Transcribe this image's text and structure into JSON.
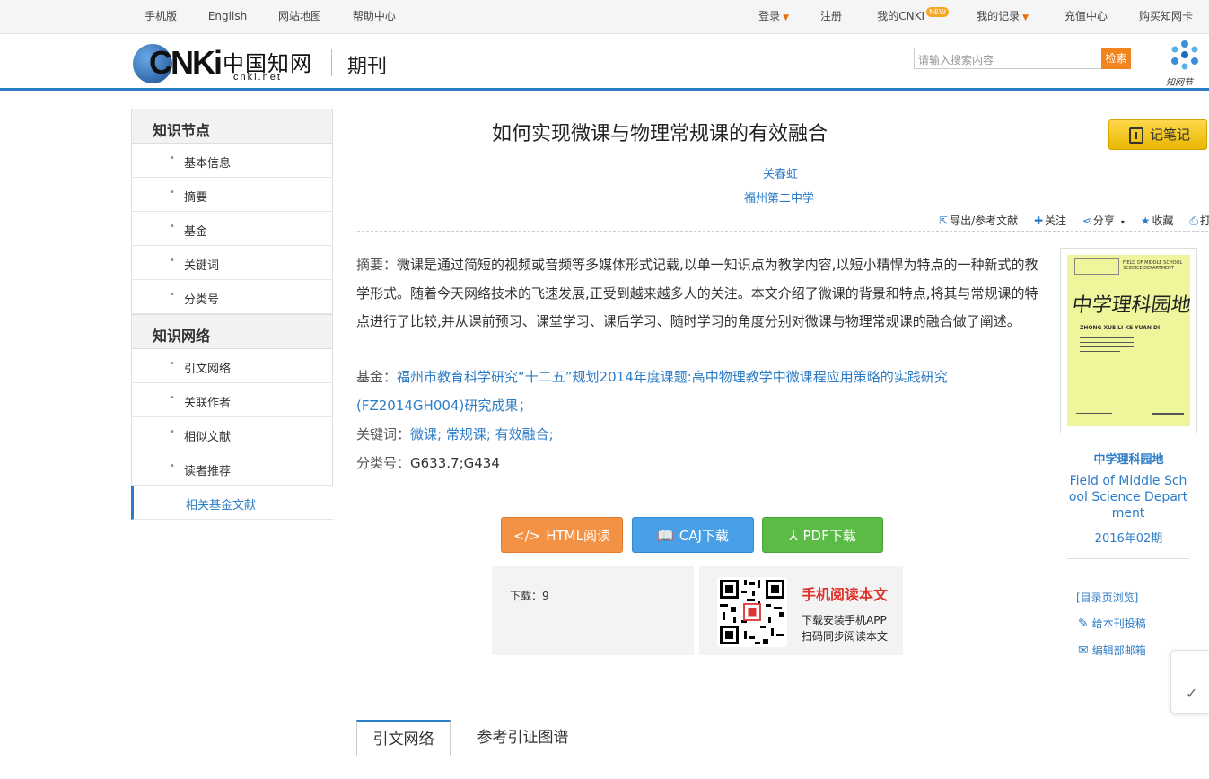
{
  "topbar": {
    "left": [
      "手机版",
      "English",
      "网站地图",
      "帮助中心"
    ],
    "login": "登录",
    "register": "注册",
    "my_cnki": "我的CNKI",
    "new_badge": "NEW",
    "my_records": "我的记录",
    "recharge": "充值中心",
    "buy_card": "购买知网卡"
  },
  "header": {
    "logo_letters": "CNKi",
    "logo_cn": "中国知网",
    "logo_sub": "cnki.net",
    "section": "期刊",
    "search_placeholder": "请输入搜索内容",
    "search_button": "检索",
    "zhiwang_text": "知网节"
  },
  "sidebar": {
    "node_head": "知识节点",
    "node_items": [
      "基本信息",
      "摘要",
      "基金",
      "关键词",
      "分类号"
    ],
    "network_head": "知识网络",
    "network_items": [
      "引文网络",
      "关联作者",
      "相似文献",
      "读者推荐",
      "相关基金文献"
    ]
  },
  "article": {
    "title": "如何实现微课与物理常规课的有效融合",
    "note_button": "记笔记",
    "author": "关春虹",
    "org": "福州第二中学",
    "tools": [
      "导出/参考文献",
      "关注",
      "分享",
      "收藏",
      "打印"
    ],
    "abstract_label": "摘要：",
    "abstract": "微课是通过简短的视频或音频等多媒体形式记载,以单一知识点为教学内容,以短小精悍为特点的一种新式的教学形式。随着今天网络技术的飞速发展,正受到越来越多人的关注。本文介绍了微课的背景和特点,将其与常规课的特点进行了比较,并从课前预习、课堂学习、课后学习、随时学习的角度分别对微课与物理常规课的融合做了阐述。",
    "fund_label": "基金：",
    "fund": "福州市教育科学研究“十二五”规划2014年度课题:高中物理教学中微课程应用策略的实践研究(FZ2014GH004)研究成果；",
    "keywords_label": "关键词：",
    "keywords": "微课; 常规课; 有效融合;",
    "clc_label": "分类号：",
    "clc": "G633.7;G434"
  },
  "downloads": {
    "html": "HTML阅读",
    "caj": "CAJ下载",
    "pdf": "PDF下载",
    "count_label": "下载：",
    "count": "9",
    "mobile_title": "手机阅读本文",
    "mobile_line1": "下载安装手机APP",
    "mobile_line2": "扫码同步阅读本文"
  },
  "journal": {
    "cover_title": "中学理科园地",
    "cover_sub": "ZHONG XUE LI KE YUAN DI",
    "cover_top": "FIELD OF MIDDLE SCHOOL SCIENCE DEPARTMENT",
    "name_cn": "中学理科园地",
    "name_en": "Field of Middle School Science Department",
    "issue": "2016年02期",
    "browse": "[目录页浏览]",
    "submit": "给本刊投稿",
    "editor_mail": "编辑部邮箱"
  },
  "tabs": [
    "引文网络",
    "参考引证图谱"
  ],
  "colors": {
    "accent": "#2c7cc6",
    "orange": "#f39144",
    "blue": "#4aa0e6",
    "green": "#5bbb47",
    "red": "#e0302a"
  }
}
